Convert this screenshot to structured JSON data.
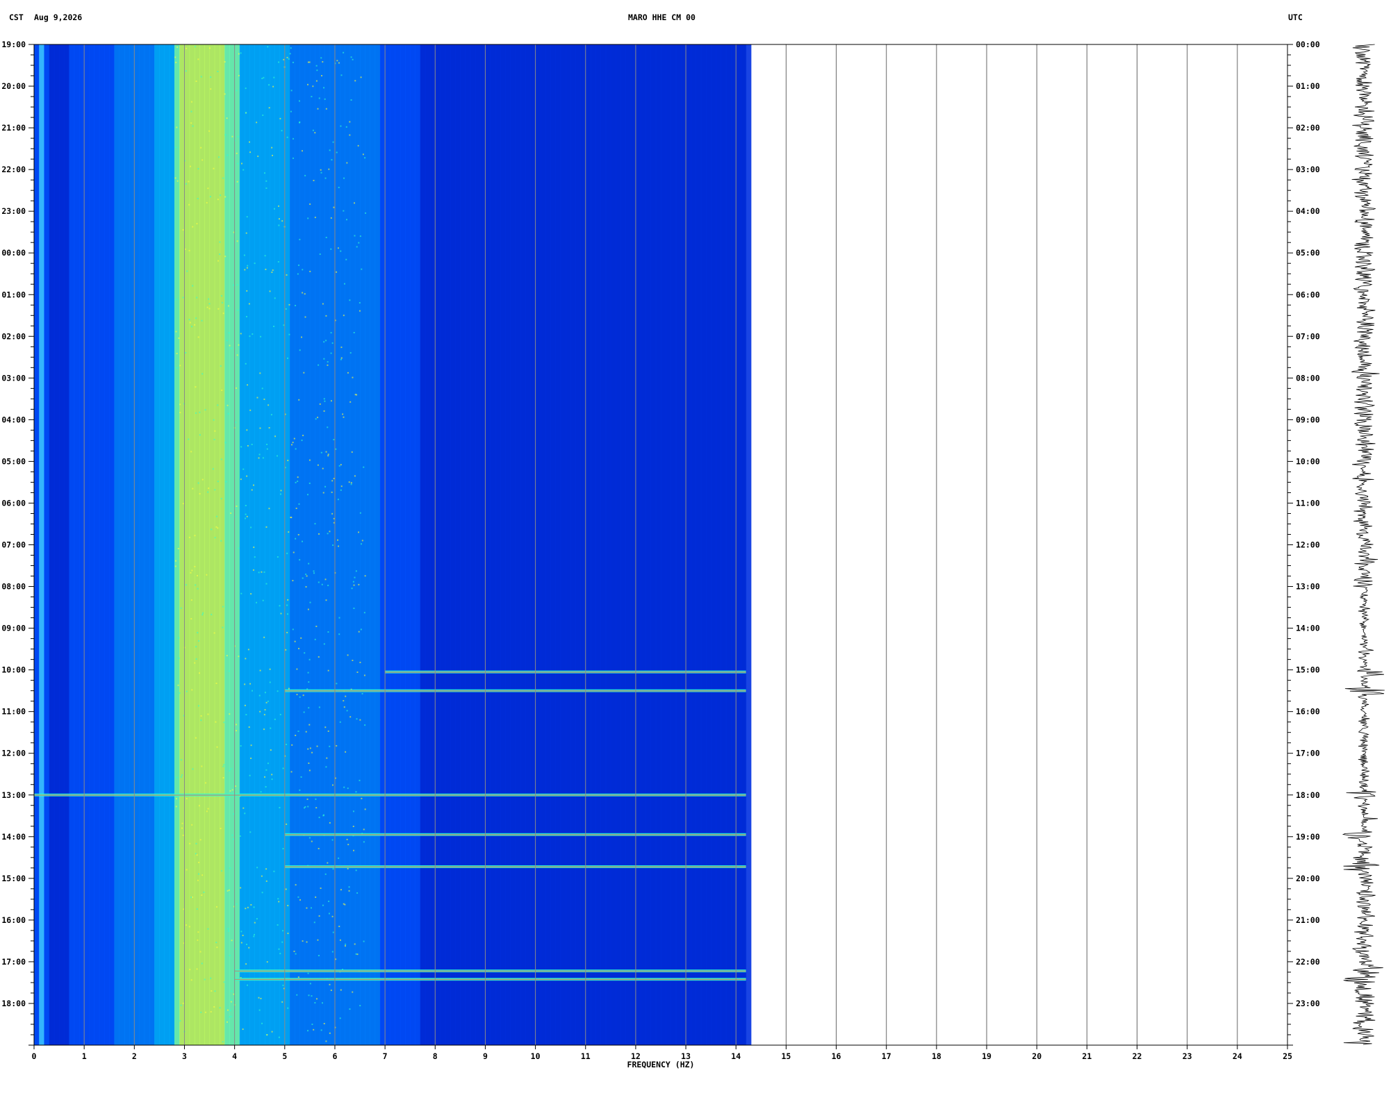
{
  "header": {
    "left_timezone": "CST",
    "date": "Aug 9,2026",
    "station": "MARO HHE CM 00",
    "right_timezone": "UTC"
  },
  "chart_data": {
    "type": "heatmap",
    "title": "MARO HHE CM 00",
    "xlabel": "FREQUENCY (HZ)",
    "xlim": [
      0,
      25
    ],
    "data_extent_hz": 14.2,
    "x_ticks": [
      "0",
      "1",
      "2",
      "3",
      "4",
      "5",
      "6",
      "7",
      "8",
      "9",
      "10",
      "11",
      "12",
      "13",
      "14",
      "15",
      "16",
      "17",
      "18",
      "19",
      "20",
      "21",
      "22",
      "23",
      "24",
      "25"
    ],
    "left_time_ticks": [
      "19:00",
      "20:00",
      "21:00",
      "22:00",
      "23:00",
      "00:00",
      "01:00",
      "02:00",
      "03:00",
      "04:00",
      "05:00",
      "06:00",
      "07:00",
      "08:00",
      "09:00",
      "10:00",
      "11:00",
      "12:00",
      "13:00",
      "14:00",
      "15:00",
      "16:00",
      "17:00",
      "18:00"
    ],
    "right_time_ticks": [
      "00:00",
      "01:00",
      "02:00",
      "03:00",
      "04:00",
      "05:00",
      "06:00",
      "07:00",
      "08:00",
      "09:00",
      "10:00",
      "11:00",
      "12:00",
      "13:00",
      "14:00",
      "15:00",
      "16:00",
      "17:00",
      "18:00",
      "19:00",
      "20:00",
      "21:00",
      "22:00",
      "23:00"
    ],
    "hours": 24,
    "energy_band_hz": [
      2.8,
      4.1
    ],
    "strong_events_local": [
      {
        "hour": 19.72,
        "fmin": 5.0,
        "fmax": 14.2
      },
      {
        "hour": 22.22,
        "fmin": 4.0,
        "fmax": 14.2
      },
      {
        "hour": 22.42,
        "fmin": 4.0,
        "fmax": 14.2
      },
      {
        "hour": 15.05,
        "fmin": 7.0,
        "fmax": 14.2
      },
      {
        "hour": 15.5,
        "fmin": 5.0,
        "fmax": 14.2
      },
      {
        "hour": 18.0,
        "fmin": 0.0,
        "fmax": 14.2
      },
      {
        "hour": 18.95,
        "fmin": 5.0,
        "fmax": 14.2
      }
    ],
    "colors": {
      "background": "#00007f",
      "mid": "#0060ff",
      "high": "#30ffd0",
      "peak": "#ffff40"
    },
    "grid": true
  }
}
